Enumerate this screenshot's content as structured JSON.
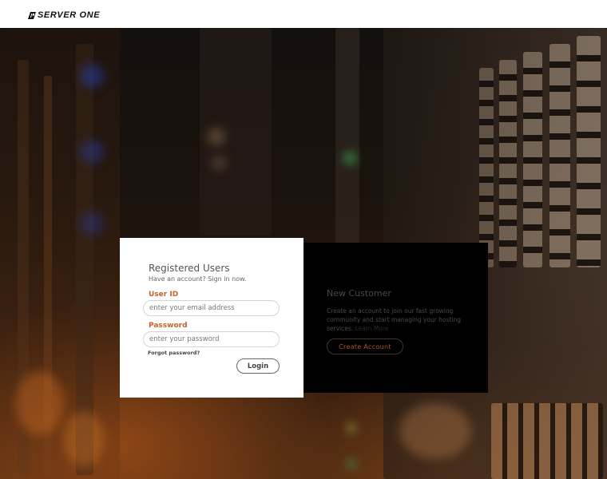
{
  "brand": {
    "logo_text": "SERVER ONE"
  },
  "login": {
    "title": "Registered Users",
    "subtitle": "Have an account? Sign in now.",
    "user_label": "User ID",
    "user_placeholder": "enter your email address",
    "password_label": "Password",
    "password_placeholder": "enter your password",
    "forgot_label": "Forgot password?",
    "login_label": "Login"
  },
  "new_customer": {
    "title": "New Customer",
    "description": "Create an account to join our fast growing community and start managing your hosting services.",
    "learn_more": "Learn More",
    "create_label": "Create Account"
  },
  "colors": {
    "accent": "#c0642a",
    "header_bg": "#ffffff",
    "dark_panel": "#000000"
  }
}
